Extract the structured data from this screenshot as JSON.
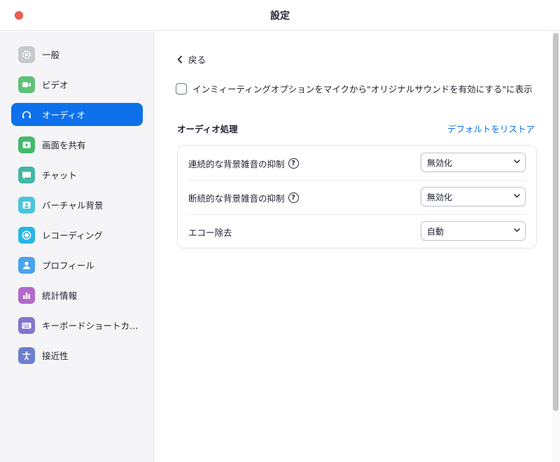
{
  "window": {
    "title": "設定"
  },
  "sidebar": {
    "items": [
      {
        "label": "一般",
        "icon": "gear-icon",
        "color": "#c7c9cc",
        "active": false
      },
      {
        "label": "ビデオ",
        "icon": "video-camera-icon",
        "color": "#5ec179",
        "active": false
      },
      {
        "label": "オーディオ",
        "icon": "headphones-icon",
        "color": "#0e71eb",
        "active": true
      },
      {
        "label": "画面を共有",
        "icon": "share-screen-icon",
        "color": "#45b96c",
        "active": false
      },
      {
        "label": "チャット",
        "icon": "chat-bubble-icon",
        "color": "#44b7a5",
        "active": false
      },
      {
        "label": "バーチャル背景",
        "icon": "virtual-background-icon",
        "color": "#4bc3dc",
        "active": false
      },
      {
        "label": "レコーディング",
        "icon": "record-icon",
        "color": "#2ab5e6",
        "active": false
      },
      {
        "label": "プロフィール",
        "icon": "user-icon",
        "color": "#4aa3ea",
        "active": false
      },
      {
        "label": "統計情報",
        "icon": "bar-chart-icon",
        "color": "#b26ac9",
        "active": false
      },
      {
        "label": "キーボードショートカ…",
        "icon": "keyboard-icon",
        "color": "#8276cf",
        "active": false
      },
      {
        "label": "接近性",
        "icon": "accessibility-icon",
        "color": "#6c7ecc",
        "active": false
      }
    ]
  },
  "main": {
    "back_label": "戻る",
    "meeting_option": {
      "label": "インミィーティングオプションをマイクから\"オリジナルサウンドを有効にする\"に表示",
      "checked": false
    },
    "section_title": "オーディオ処理",
    "restore_link": "デフォルトをリストア",
    "settings": [
      {
        "label": "連続的な背景雑音の抑制",
        "has_help": true,
        "value": "無効化"
      },
      {
        "label": "断続的な背景雑音の抑制",
        "has_help": true,
        "value": "無効化"
      },
      {
        "label": "エコー除去",
        "has_help": false,
        "value": "自動"
      }
    ],
    "help_glyph": "?"
  },
  "colors": {
    "accent": "#0e71eb",
    "close_button": "#ee5e55"
  }
}
